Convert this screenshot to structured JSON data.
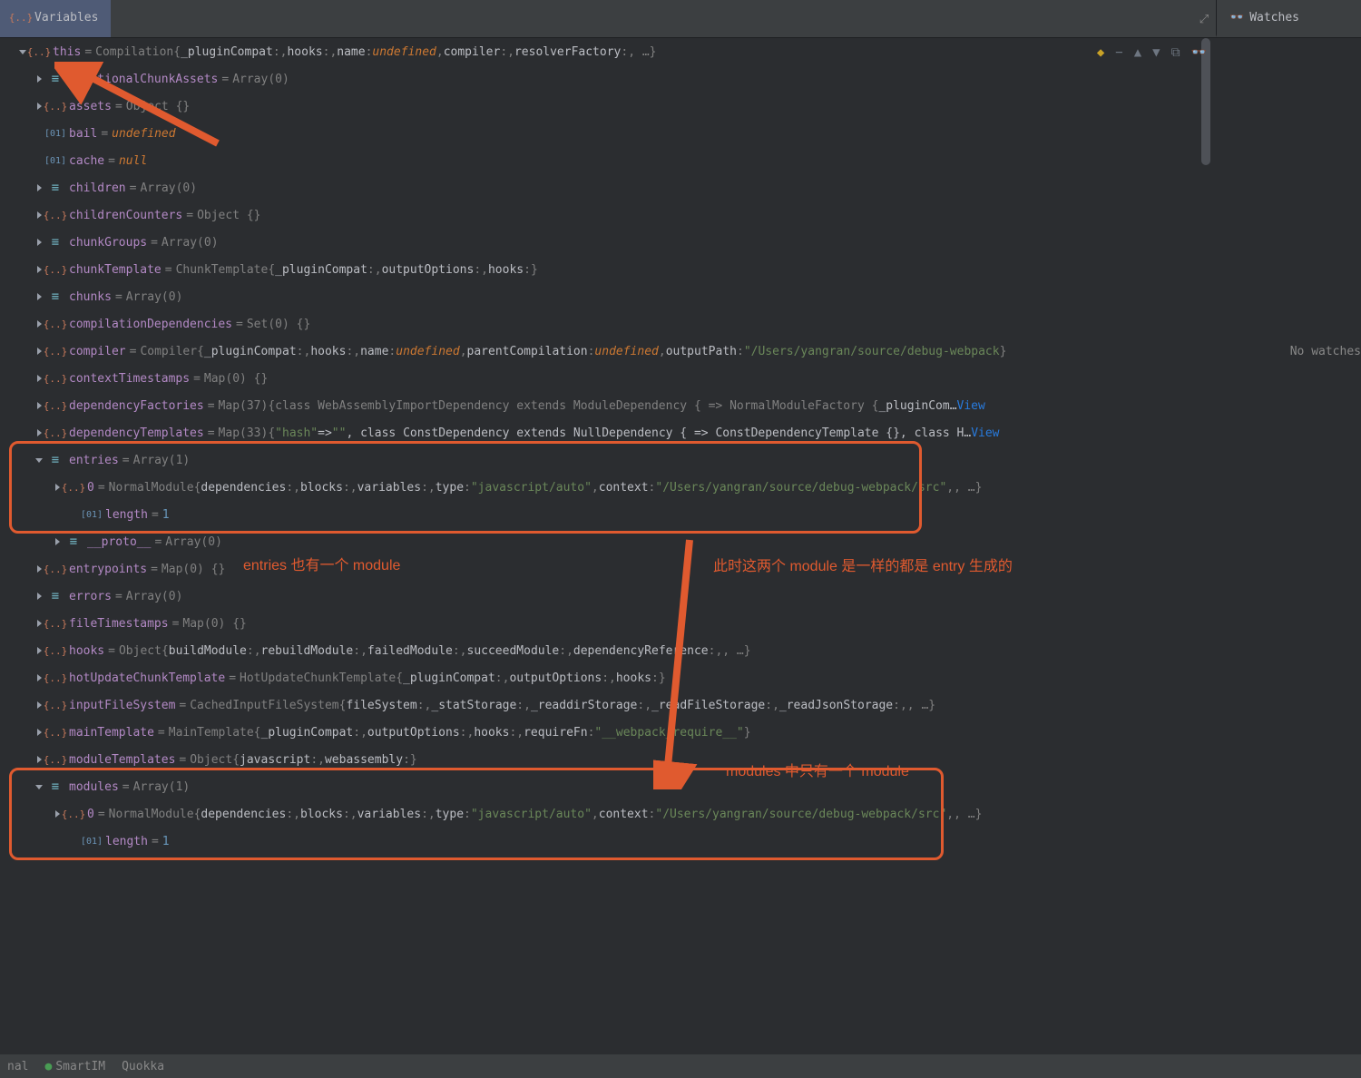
{
  "panels": {
    "variables_label": "Variables",
    "watches_label": "Watches"
  },
  "no_watches": "No watches",
  "bottom": {
    "item1": "nal",
    "item2": "SmartIM",
    "item3": "Quokka"
  },
  "actions": {
    "bookmark": "◆",
    "minus": "−",
    "up": "▲",
    "down": "▼",
    "copy": "⧉",
    "glasses": "👓"
  },
  "root": {
    "name": "this",
    "type": "Compilation",
    "preview": {
      "p1": "_pluginCompat",
      "p2": "hooks",
      "p3": "name",
      "v3": "undefined",
      "p4": "compiler",
      "p5": "resolverFactory"
    }
  },
  "rows": [
    {
      "k": "additionalChunkAssets",
      "t": "arr",
      "v": "Array(0)"
    },
    {
      "k": "assets",
      "t": "obj",
      "v": "Object {}"
    },
    {
      "k": "bail",
      "t": "prim",
      "v": "undefined",
      "vc": "undef"
    },
    {
      "k": "cache",
      "t": "prim",
      "v": "null",
      "vc": "nullv"
    },
    {
      "k": "children",
      "t": "arr",
      "v": "Array(0)"
    },
    {
      "k": "childrenCounters",
      "t": "obj",
      "v": "Object {}"
    },
    {
      "k": "chunkGroups",
      "t": "arr",
      "v": "Array(0)"
    },
    {
      "k": "chunkTemplate",
      "t": "obj",
      "v": "ChunkTemplate",
      "preview": [
        {
          "n": "_pluginCompat"
        },
        {
          "n": "outputOptions"
        },
        {
          "n": "hooks"
        }
      ]
    },
    {
      "k": "chunks",
      "t": "arr",
      "v": "Array(0)"
    },
    {
      "k": "compilationDependencies",
      "t": "obj",
      "v": "Set(0) {}"
    },
    {
      "k": "compiler",
      "t": "obj",
      "v": "Compiler",
      "preview": [
        {
          "n": "_pluginCompat"
        },
        {
          "n": "hooks"
        },
        {
          "n": "name",
          "val": "undefined",
          "vc": "undef"
        },
        {
          "n": "parentCompilation",
          "val": "undefined",
          "vc": "undef"
        },
        {
          "n": "outputPath",
          "val": "\"/Users/yangran/source/debug-webpack",
          "vc": "str"
        }
      ]
    },
    {
      "k": "contextTimestamps",
      "t": "obj",
      "v": "Map(0) {}"
    },
    {
      "k": "dependencyFactories",
      "t": "obj",
      "v": "Map(37)",
      "rest": "{class WebAssemblyImportDependency extends ModuleDependency { => NormalModuleFactory {",
      "pn": "_pluginCom…",
      "view": "View"
    },
    {
      "k": "dependencyTemplates",
      "t": "obj",
      "v": "Map(33)",
      "rest2": [
        {
          "s": "\"hash\"",
          "c": "str"
        },
        {
          "s": " => ",
          "c": ""
        },
        {
          "s": "\"\"",
          "c": "str"
        },
        {
          "s": ", class ConstDependency extends NullDependency { => ConstDependencyTemplate {}, class H…",
          "c": ""
        }
      ],
      "view": "View"
    },
    {
      "k": "entries",
      "t": "arr",
      "v": "Array(1)",
      "expanded": true
    },
    {
      "k": "entrypoints",
      "t": "obj",
      "v": "Map(0) {}"
    },
    {
      "k": "errors",
      "t": "arr",
      "v": "Array(0)"
    },
    {
      "k": "fileTimestamps",
      "t": "obj",
      "v": "Map(0) {}"
    },
    {
      "k": "hooks",
      "t": "obj",
      "v": "Object",
      "preview": [
        {
          "n": "buildModule"
        },
        {
          "n": "rebuildModule"
        },
        {
          "n": "failedModule"
        },
        {
          "n": "succeedModule"
        },
        {
          "n": "dependencyReference"
        },
        {
          "n": "…"
        }
      ]
    },
    {
      "k": "hotUpdateChunkTemplate",
      "t": "obj",
      "v": "HotUpdateChunkTemplate",
      "preview": [
        {
          "n": "_pluginCompat"
        },
        {
          "n": "outputOptions"
        },
        {
          "n": "hooks"
        }
      ]
    },
    {
      "k": "inputFileSystem",
      "t": "obj",
      "v": "CachedInputFileSystem",
      "preview": [
        {
          "n": "fileSystem"
        },
        {
          "n": "_statStorage"
        },
        {
          "n": "_readdirStorage"
        },
        {
          "n": "_readFileStorage"
        },
        {
          "n": "_readJsonStorage"
        },
        {
          "n": "…"
        }
      ]
    },
    {
      "k": "mainTemplate",
      "t": "obj",
      "v": "MainTemplate",
      "preview": [
        {
          "n": "_pluginCompat"
        },
        {
          "n": "outputOptions"
        },
        {
          "n": "hooks"
        },
        {
          "n": "requireFn",
          "val": "\"__webpack_require__\"",
          "vc": "str"
        }
      ]
    },
    {
      "k": "moduleTemplates",
      "t": "obj",
      "v": "Object",
      "preview": [
        {
          "n": "javascript"
        },
        {
          "n": "webassembly"
        }
      ]
    },
    {
      "k": "modules",
      "t": "arr",
      "v": "Array(1)",
      "expanded": true
    }
  ],
  "entries_sub": {
    "idx": "0",
    "type": "NormalModule",
    "preview": [
      {
        "n": "dependencies"
      },
      {
        "n": "blocks"
      },
      {
        "n": "variables"
      },
      {
        "n": "type",
        "val": "\"javascript/auto\"",
        "vc": "str"
      },
      {
        "n": "context",
        "val": "\"/Users/yangran/source/debug-webpack/src\"",
        "vc": "str"
      },
      {
        "n": "…"
      }
    ],
    "length_label": "length",
    "length_val": "1",
    "proto_label": "__proto__",
    "proto_val": "Array(0)"
  },
  "modules_sub": {
    "idx": "0",
    "type": "NormalModule",
    "preview": [
      {
        "n": "dependencies"
      },
      {
        "n": "blocks"
      },
      {
        "n": "variables"
      },
      {
        "n": "type",
        "val": "\"javascript/auto\"",
        "vc": "str"
      },
      {
        "n": "context",
        "val": "\"/Users/yangran/source/debug-webpack/src\"",
        "vc": "str"
      },
      {
        "n": "…"
      }
    ],
    "length_label": "length",
    "length_val": "1"
  },
  "annotations": {
    "a1": "entries 也有一个 module",
    "a2": "此时这两个 module 是一样的都是 entry 生成的",
    "a3": "modules 中只有一个  module"
  }
}
